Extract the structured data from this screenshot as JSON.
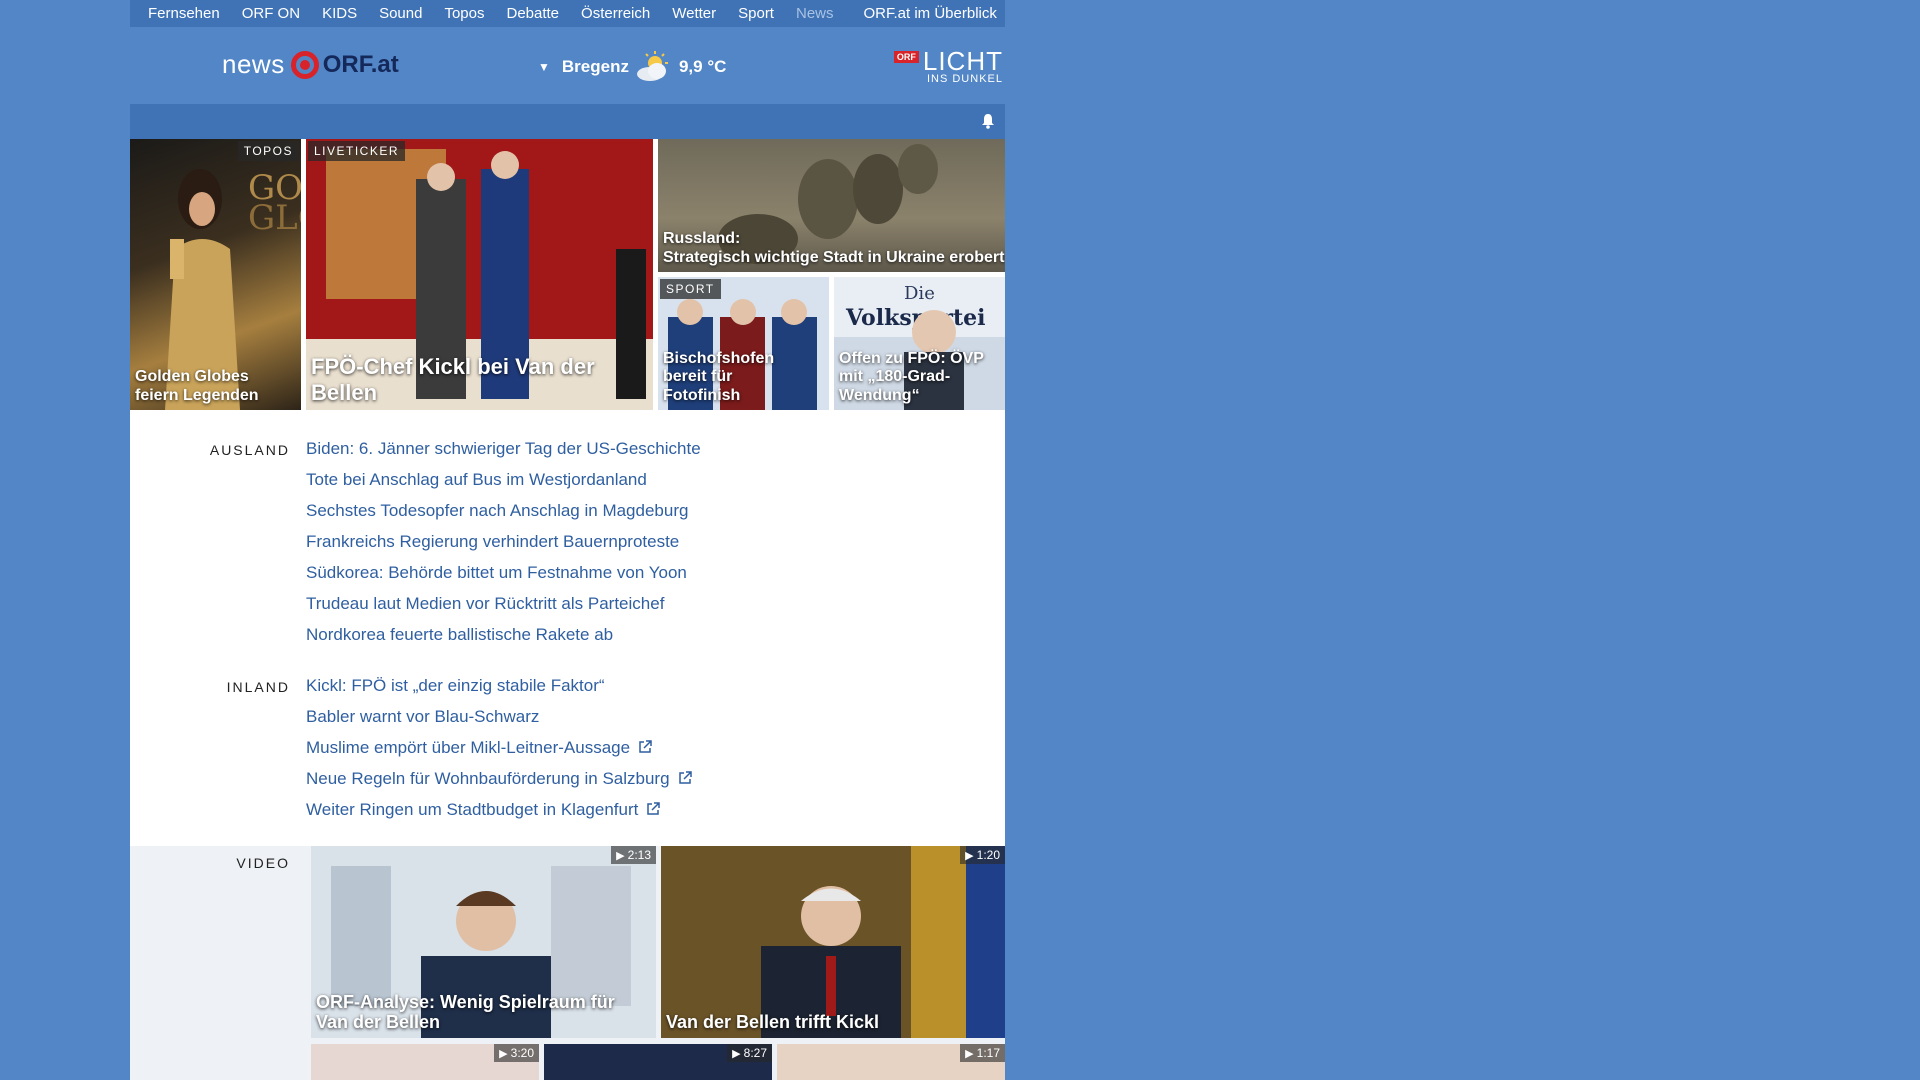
{
  "nav": {
    "items": [
      "Fernsehen",
      "ORF ON",
      "KIDS",
      "Sound",
      "Topos",
      "Debatte",
      "Österreich",
      "Wetter",
      "Sport",
      "News"
    ],
    "overview": "ORF.at im Überblick"
  },
  "logo": {
    "news": "news",
    "orf": "ORF.at"
  },
  "weather": {
    "city": "Bregenz",
    "temp": "9,9 °C"
  },
  "licht": {
    "badge": "ORF",
    "big": "LICHT",
    "small": "INS DUNKEL"
  },
  "teasers": {
    "golden": {
      "tag": "TOPOS",
      "caption": "Golden Globes feiern Legenden"
    },
    "kickl": {
      "tag": "LIVETICKER",
      "caption": "FPÖ-Chef Kickl bei Van der Bellen"
    },
    "russland": {
      "caption_l1": "Russland:",
      "caption_l2": "Strategisch wichtige Stadt in Ukraine erobert"
    },
    "bischofs": {
      "tag": "SPORT",
      "caption": "Bischofshofen bereit für Fotofinish"
    },
    "oevp": {
      "caption": "Offen zu FPÖ: ÖVP mit „180-Grad-Wendung“",
      "sign_l1": "Die",
      "sign_l2": "Volkspartei"
    }
  },
  "ausland": {
    "label": "AUSLAND",
    "items": [
      "Biden: 6. Jänner schwieriger Tag der US-Geschichte",
      "Tote bei Anschlag auf Bus im Westjordanland",
      "Sechstes Todesopfer nach Anschlag in Magdeburg",
      "Frankreichs Regierung verhindert Bauernproteste",
      "Südkorea: Behörde bittet um Festnahme von Yoon",
      "Trudeau laut Medien vor Rücktritt als Parteichef",
      "Nordkorea feuerte ballistische Rakete ab"
    ]
  },
  "inland": {
    "label": "INLAND",
    "items": [
      "Kickl: FPÖ ist „der einzig stabile Faktor“",
      "Babler warnt vor Blau-Schwarz",
      "Muslime empört über Mikl-Leitner-Aussage",
      "Neue Regeln für Wohnbauförderung in Salzburg",
      "Weiter Ringen um Stadtbudget in Klagenfurt"
    ]
  },
  "video": {
    "label": "VIDEO",
    "v1": {
      "dur": "2:13",
      "caption": "ORF-Analyse: Wenig Spielraum für Van der Bellen"
    },
    "v2": {
      "dur": "1:20",
      "caption": "Van der Bellen trifft Kickl"
    },
    "v3": {
      "dur": "3:20"
    },
    "v4": {
      "dur": "8:27"
    },
    "v5": {
      "dur": "1:17"
    }
  },
  "colors": {
    "page_bg": "#5286c6",
    "nav_bg": "#3f73b5",
    "link": "#2f5fa0",
    "orf_red": "#d8232a"
  }
}
